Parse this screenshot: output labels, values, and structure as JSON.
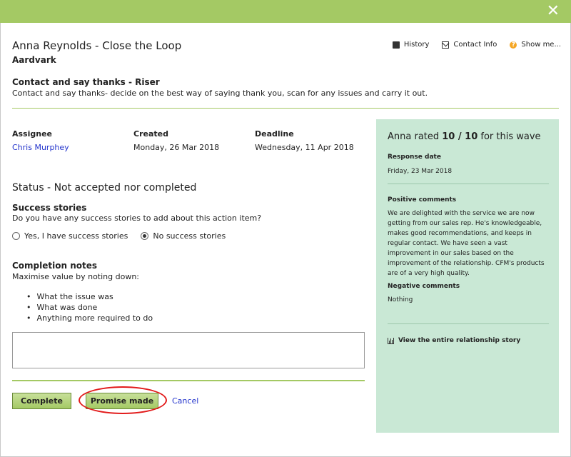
{
  "window": {
    "close_glyph": "✕"
  },
  "header": {
    "title": "Anna Reynolds - Close the Loop",
    "company": "Aardvark",
    "links": [
      {
        "label": "History",
        "icon": "book-icon"
      },
      {
        "label": "Contact Info",
        "icon": "mail-icon"
      },
      {
        "label": "Show me...",
        "icon": "help-icon"
      }
    ]
  },
  "action": {
    "title": "Contact and say thanks - Riser",
    "description": "Contact and say thanks- decide on the best way of saying thank you, scan for any issues and carry it out."
  },
  "details": {
    "assignee_label": "Assignee",
    "assignee": "Chris Murphey",
    "created_label": "Created",
    "created": "Monday, 26 Mar 2018",
    "deadline_label": "Deadline",
    "deadline": "Wednesday, 11 Apr 2018"
  },
  "status": "Status - Not accepted nor completed",
  "success_stories": {
    "title": "Success stories",
    "question": "Do you have any success stories to add about this action item?",
    "options": [
      {
        "label": "Yes, I have success stories",
        "selected": false
      },
      {
        "label": "No success stories",
        "selected": true
      }
    ]
  },
  "completion_notes": {
    "title": "Completion notes",
    "description": "Maximise value by noting down:",
    "bullets": [
      "What the issue was",
      "What was done",
      "Anything more required to do"
    ],
    "value": ""
  },
  "buttons": {
    "complete": "Complete",
    "promise": "Promise made",
    "cancel": "Cancel"
  },
  "panel": {
    "title_prefix": "Anna rated ",
    "rating": "10 / 10",
    "title_suffix": " for this wave",
    "response_date_label": "Response date",
    "response_date": "Friday, 23 Mar 2018",
    "positive_label": "Positive comments",
    "positive": "We are delighted with the service we are now getting from our sales rep. He's knowledgeable, makes good recommendations, and keeps in regular contact. We have seen a vast improvement in our sales based on the improvement of the relationship. CFM's products are of a very high quality.",
    "negative_label": "Negative comments",
    "negative": "Nothing",
    "story_link": "View the entire relationship story"
  },
  "colors": {
    "accent": "#a4c964",
    "panel_bg": "#c9e8d5",
    "link": "#2233cc",
    "highlight": "#e21b1b"
  }
}
